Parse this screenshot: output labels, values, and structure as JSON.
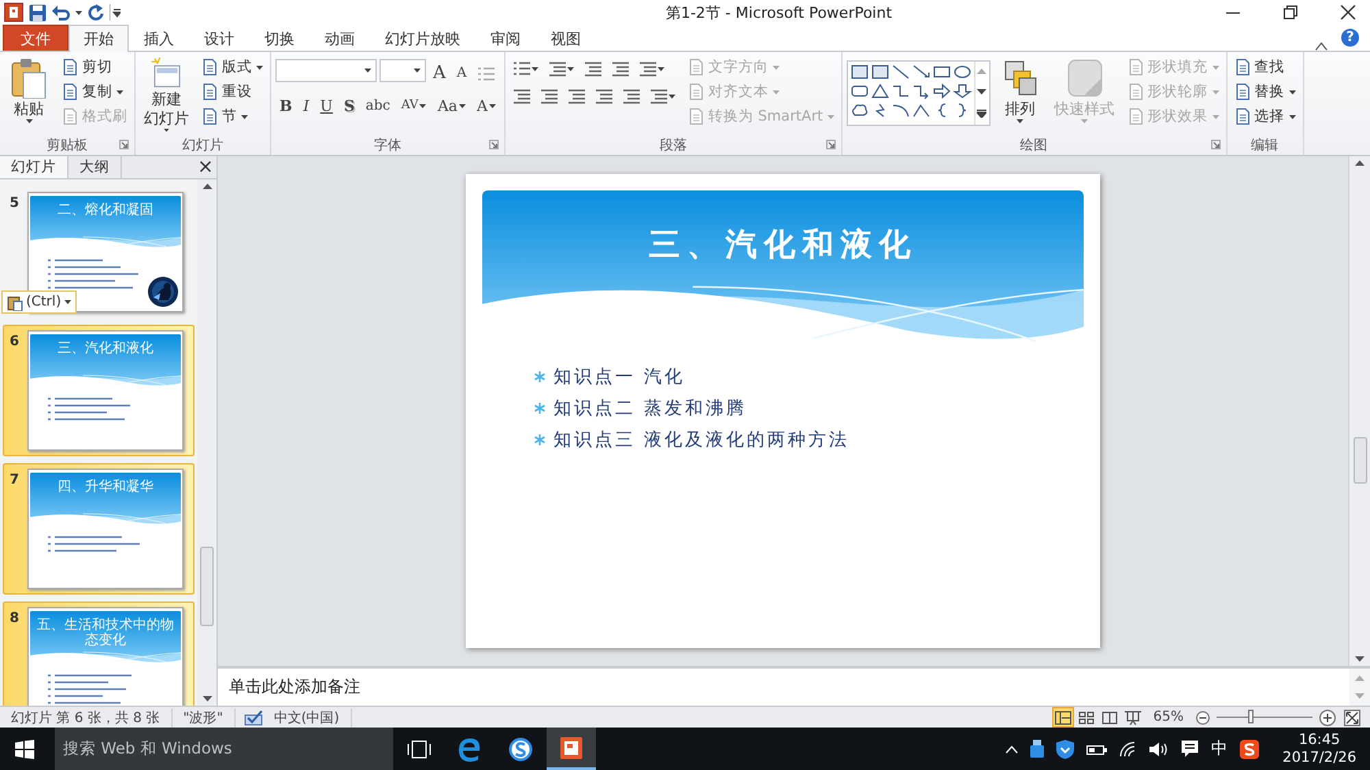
{
  "window": {
    "title": "第1-2节 - Microsoft PowerPoint",
    "help": "?"
  },
  "tabs": [
    {
      "label": "文件",
      "kind": "file",
      "selected": false
    },
    {
      "label": "开始",
      "kind": "tab",
      "selected": true
    },
    {
      "label": "插入",
      "kind": "tab",
      "selected": false
    },
    {
      "label": "设计",
      "kind": "tab",
      "selected": false
    },
    {
      "label": "切换",
      "kind": "tab",
      "selected": false
    },
    {
      "label": "动画",
      "kind": "tab",
      "selected": false
    },
    {
      "label": "幻灯片放映",
      "kind": "tab",
      "selected": false
    },
    {
      "label": "审阅",
      "kind": "tab",
      "selected": false
    },
    {
      "label": "视图",
      "kind": "tab",
      "selected": false
    }
  ],
  "ribbon": {
    "groups": [
      {
        "label": "剪贴板",
        "launcher": true,
        "columns": [
          [
            [
              {
                "kind": "large",
                "lines": [
                  "粘贴"
                ],
                "dropdown": true,
                "disabled": false
              }
            ]
          ],
          [
            [
              {
                "kind": "small",
                "label": "剪切",
                "dropdown": false,
                "disabled": false
              }
            ],
            [
              {
                "kind": "small",
                "label": "复制",
                "dropdown": true,
                "disabled": false
              }
            ],
            [
              {
                "kind": "small",
                "label": "格式刷",
                "dropdown": false,
                "disabled": true
              }
            ]
          ]
        ]
      },
      {
        "label": "幻灯片",
        "launcher": false,
        "columns": [
          [
            [
              {
                "kind": "large",
                "lines": [
                  "新建",
                  "幻灯片"
                ],
                "dropdown": true,
                "disabled": false
              }
            ]
          ],
          [
            [
              {
                "kind": "small",
                "label": "版式",
                "dropdown": true,
                "disabled": false
              }
            ],
            [
              {
                "kind": "small",
                "label": "重设",
                "dropdown": false,
                "disabled": false
              }
            ],
            [
              {
                "kind": "small",
                "label": "节",
                "dropdown": true,
                "disabled": false
              }
            ]
          ]
        ]
      },
      {
        "label": "字体",
        "launcher": true,
        "columns": [
          [
            [
              {
                "kind": "field"
              },
              {
                "kind": "field"
              },
              {
                "kind": "glyph",
                "label": "A",
                "dropdown": false,
                "disabled": false
              },
              {
                "kind": "glyph",
                "label": "A",
                "dropdown": false,
                "disabled": false
              },
              {
                "kind": "icon",
                "dropdown": false,
                "disabled": true
              }
            ],
            [
              {
                "kind": "glyph",
                "label": "B",
                "dropdown": false,
                "disabled": false
              },
              {
                "kind": "glyph",
                "label": "I",
                "dropdown": false,
                "disabled": false
              },
              {
                "kind": "glyph",
                "label": "U",
                "dropdown": false,
                "disabled": false
              },
              {
                "kind": "glyph",
                "label": "S",
                "dropdown": false,
                "disabled": false
              },
              {
                "kind": "glyph",
                "label": "abc",
                "dropdown": false,
                "disabled": false
              },
              {
                "kind": "glyph",
                "label": "AV",
                "dropdown": true,
                "disabled": false
              },
              {
                "kind": "glyph",
                "label": "Aa",
                "dropdown": true,
                "disabled": false
              },
              {
                "kind": "glyph",
                "label": "A",
                "dropdown": true,
                "disabled": false
              }
            ]
          ]
        ]
      },
      {
        "label": "段落",
        "launcher": true,
        "columns": [
          [
            [
              {
                "kind": "icon",
                "dropdown": true,
                "disabled": false
              },
              {
                "kind": "icon",
                "dropdown": true,
                "disabled": false
              },
              {
                "kind": "icon",
                "dropdown": false,
                "disabled": false
              },
              {
                "kind": "icon",
                "dropdown": false,
                "disabled": false
              },
              {
                "kind": "icon",
                "dropdown": true,
                "disabled": false
              }
            ],
            [
              {
                "kind": "icon",
                "dropdown": false,
                "disabled": false
              },
              {
                "kind": "icon",
                "dropdown": false,
                "disabled": false
              },
              {
                "kind": "icon",
                "dropdown": false,
                "disabled": false
              },
              {
                "kind": "icon",
                "dropdown": false,
                "disabled": false
              },
              {
                "kind": "icon",
                "dropdown": false,
                "disabled": false
              },
              {
                "kind": "icon",
                "dropdown": true,
                "disabled": false
              }
            ]
          ],
          [
            [
              {
                "kind": "small",
                "label": "文字方向",
                "dropdown": true,
                "disabled": true
              }
            ],
            [
              {
                "kind": "small",
                "label": "对齐文本",
                "dropdown": true,
                "disabled": true
              }
            ],
            [
              {
                "kind": "small",
                "label": "转换为 SmartArt",
                "dropdown": true,
                "disabled": true
              }
            ]
          ]
        ]
      },
      {
        "label": "绘图",
        "launcher": true,
        "columns": [
          [
            [
              {
                "kind": "gallery"
              }
            ]
          ],
          [
            [
              {
                "kind": "large",
                "lines": [
                  "排列"
                ],
                "dropdown": true,
                "disabled": false
              }
            ]
          ],
          [
            [
              {
                "kind": "large",
                "lines": [
                  "快速样式"
                ],
                "dropdown": true,
                "disabled": true
              }
            ]
          ],
          [
            [
              {
                "kind": "small",
                "label": "形状填充",
                "dropdown": true,
                "disabled": true
              }
            ],
            [
              {
                "kind": "small",
                "label": "形状轮廓",
                "dropdown": true,
                "disabled": true
              }
            ],
            [
              {
                "kind": "small",
                "label": "形状效果",
                "dropdown": true,
                "disabled": true
              }
            ]
          ]
        ]
      },
      {
        "label": "编辑",
        "launcher": false,
        "columns": [
          [
            [
              {
                "kind": "small",
                "label": "查找",
                "dropdown": false,
                "disabled": false
              }
            ],
            [
              {
                "kind": "small",
                "label": "替换",
                "dropdown": true,
                "disabled": false
              }
            ],
            [
              {
                "kind": "small",
                "label": "选择",
                "dropdown": true,
                "disabled": false
              }
            ]
          ]
        ]
      }
    ]
  },
  "panel": {
    "tabs": [
      {
        "label": "幻灯片",
        "selected": true
      },
      {
        "label": "大纲",
        "selected": false
      }
    ],
    "close": "×",
    "slides": [
      {
        "number": "5",
        "title": "二、熔化和凝固",
        "selected": false
      },
      {
        "number": "6",
        "title": "三、汽化和液化",
        "selected": true
      },
      {
        "number": "7",
        "title": "四、升华和凝华",
        "selected": true
      },
      {
        "number": "8",
        "title": "五、生活和技术中的物态变化",
        "selected": true
      }
    ],
    "paste_options": "(Ctrl)"
  },
  "slide": {
    "title": "三、汽化和液化",
    "bullets": [
      "知识点一 汽化",
      "知识点二 蒸发和沸腾",
      "知识点三 液化及液化的两种方法"
    ]
  },
  "notes": {
    "prompt": "单击此处添加备注"
  },
  "status_bar": {
    "slide_info": "幻灯片 第 6 张，共 8 张",
    "theme": "\"波形\"",
    "language": "中文(中国)",
    "views": [
      {
        "selected": true
      },
      {
        "selected": false
      },
      {
        "selected": false
      },
      {
        "selected": false
      }
    ],
    "zoom": "65%",
    "zoom_level": {
      "level": 0.36
    }
  },
  "taskbar": {
    "search": "搜索 Web 和 Windows",
    "apps": [
      {
        "selected": false
      },
      {
        "selected": false
      },
      {
        "selected": false
      },
      {
        "selected": true
      }
    ],
    "ime": "中",
    "time": "16:45",
    "date": "2017/2/26"
  }
}
